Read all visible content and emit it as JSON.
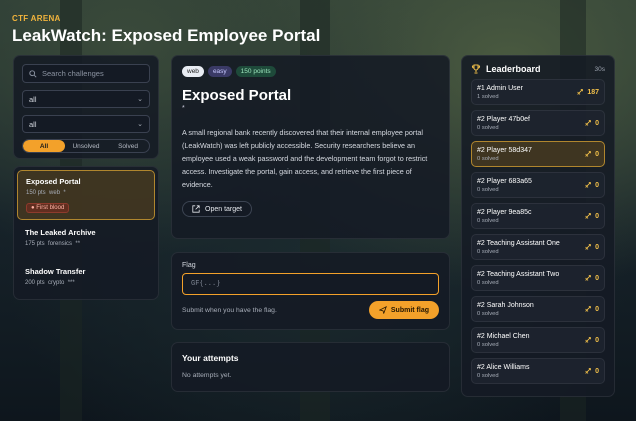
{
  "app": {
    "eyebrow": "CTF ARENA",
    "title": "LeakWatch: Exposed Employee Portal"
  },
  "filters": {
    "search_placeholder": "Search challenges",
    "category_value": "all",
    "difficulty_value": "all",
    "segments": [
      "All",
      "Unsolved",
      "Solved"
    ],
    "active_segment": "All"
  },
  "challenges": [
    {
      "title": "Exposed Portal",
      "points": "150 pts",
      "category": "web",
      "stars": "*",
      "badge": "First blood"
    },
    {
      "title": "The Leaked Archive",
      "points": "175 pts",
      "category": "forensics",
      "stars": "**"
    },
    {
      "title": "Shadow Transfer",
      "points": "200 pts",
      "category": "crypto",
      "stars": "***"
    }
  ],
  "challenge": {
    "tags": [
      "web",
      "easy",
      "150 points"
    ],
    "title": "Exposed Portal",
    "stars": "*",
    "description": "A small regional bank recently discovered that their internal employee portal (LeakWatch) was left publicly accessible. Security researchers believe an employee used a weak password and the development team forgot to restrict access. Investigate the portal, gain access, and retrieve the first piece of evidence.",
    "open_target": "Open target"
  },
  "flag": {
    "label": "Flag",
    "placeholder": "GF{...}",
    "hint": "Submit when you have the flag.",
    "submit": "Submit flag"
  },
  "attempts": {
    "title": "Your attempts",
    "empty": "No attempts yet."
  },
  "leaderboard": {
    "title": "Leaderboard",
    "updated": "30s",
    "entries": [
      {
        "name": "#1 Admin User",
        "solved": "1 solved",
        "score": "187"
      },
      {
        "name": "#2 Player 47b0ef",
        "solved": "0 solved",
        "score": "0"
      },
      {
        "name": "#2 Player 58d347",
        "solved": "0 solved",
        "score": "0",
        "current": true
      },
      {
        "name": "#2 Player 683a65",
        "solved": "0 solved",
        "score": "0"
      },
      {
        "name": "#2 Player 9ea85c",
        "solved": "0 solved",
        "score": "0"
      },
      {
        "name": "#2 Teaching Assistant One",
        "solved": "0 solved",
        "score": "0"
      },
      {
        "name": "#2 Teaching Assistant Two",
        "solved": "0 solved",
        "score": "0"
      },
      {
        "name": "#2 Sarah Johnson",
        "solved": "0 solved",
        "score": "0"
      },
      {
        "name": "#2 Michael Chen",
        "solved": "0 solved",
        "score": "0"
      },
      {
        "name": "#2 Alice Williams",
        "solved": "0 solved",
        "score": "0"
      }
    ]
  },
  "colors": {
    "accent": "#f3a12a",
    "panel": "#141a24"
  }
}
